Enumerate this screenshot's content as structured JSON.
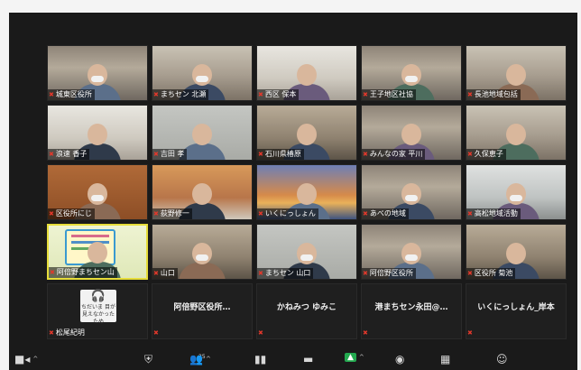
{
  "participant_count": "25",
  "participants": [
    {
      "name": "城東区役所",
      "scene": "shelves",
      "mask": true
    },
    {
      "name": "まちセン 北瀬",
      "scene": "office",
      "mask": true
    },
    {
      "name": "西区 保本",
      "scene": "bright",
      "mask": false
    },
    {
      "name": "王子地区社協",
      "scene": "shelves",
      "mask": true
    },
    {
      "name": "長池地域包括",
      "scene": "office",
      "mask": false
    },
    {
      "name": "浪速 香子",
      "scene": "bright",
      "mask": false
    },
    {
      "name": "吉田 孝",
      "scene": "plain",
      "mask": false
    },
    {
      "name": "石川県椿原",
      "scene": "room",
      "mask": false
    },
    {
      "name": "みんなの家 平川",
      "scene": "shelves",
      "mask": false
    },
    {
      "name": "久保恵子",
      "scene": "office",
      "mask": false
    },
    {
      "name": "区役所にじ",
      "scene": "brick",
      "mask": true
    },
    {
      "name": "荻野修一",
      "scene": "orange",
      "mask": false
    },
    {
      "name": "いくにっしょん",
      "scene": "bridge",
      "mask": false
    },
    {
      "name": "あべの地域",
      "scene": "shelves",
      "mask": true
    },
    {
      "name": "高松地域活動",
      "scene": "classroom",
      "mask": true
    },
    {
      "name": "阿倍野まちセン山",
      "scene": "board",
      "mask": false,
      "active": true
    },
    {
      "name": "山口",
      "scene": "room",
      "mask": true
    },
    {
      "name": "まちセン 山口",
      "scene": "plain",
      "mask": true
    },
    {
      "name": "阿倍野区役所",
      "scene": "shelves",
      "mask": true
    },
    {
      "name": "区役所 菊池",
      "scene": "room",
      "mask": false
    },
    {
      "name": "松尾紀明",
      "scene": "phone",
      "phone_text": "ちだいま 目が見えなかったため",
      "no_video": true
    },
    {
      "name": "",
      "center": "阿倍野区役所…",
      "no_video": true
    },
    {
      "name": "",
      "center": "かねみつ ゆみこ",
      "no_video": true
    },
    {
      "name": "",
      "center": "港まちセン永田@…",
      "no_video": true
    },
    {
      "name": "",
      "center": "いくにっしょん_岸本",
      "no_video": true
    }
  ],
  "toolbar": [
    {
      "icon": "video-camera-icon",
      "glyph": "■◂",
      "caret": true
    },
    {
      "icon": "security-shield-icon",
      "glyph": "⛨",
      "caret": false
    },
    {
      "icon": "participants-icon",
      "glyph": "👥",
      "caret": true
    },
    {
      "icon": "polls-icon",
      "glyph": "▮▮",
      "caret": false
    },
    {
      "icon": "chat-icon",
      "glyph": "▬",
      "caret": false
    },
    {
      "icon": "share-screen-icon",
      "glyph": "▲",
      "caret": true
    },
    {
      "icon": "record-icon",
      "glyph": "◉",
      "caret": false
    },
    {
      "icon": "breakout-rooms-icon",
      "glyph": "▦",
      "caret": false
    },
    {
      "icon": "reactions-icon",
      "glyph": "☺",
      "caret": false
    }
  ],
  "colors": {
    "window": "#1a1a1a",
    "active_border": "#e6dd3a",
    "muted_mic": "#e2382b",
    "share_green": "#23a94f"
  }
}
